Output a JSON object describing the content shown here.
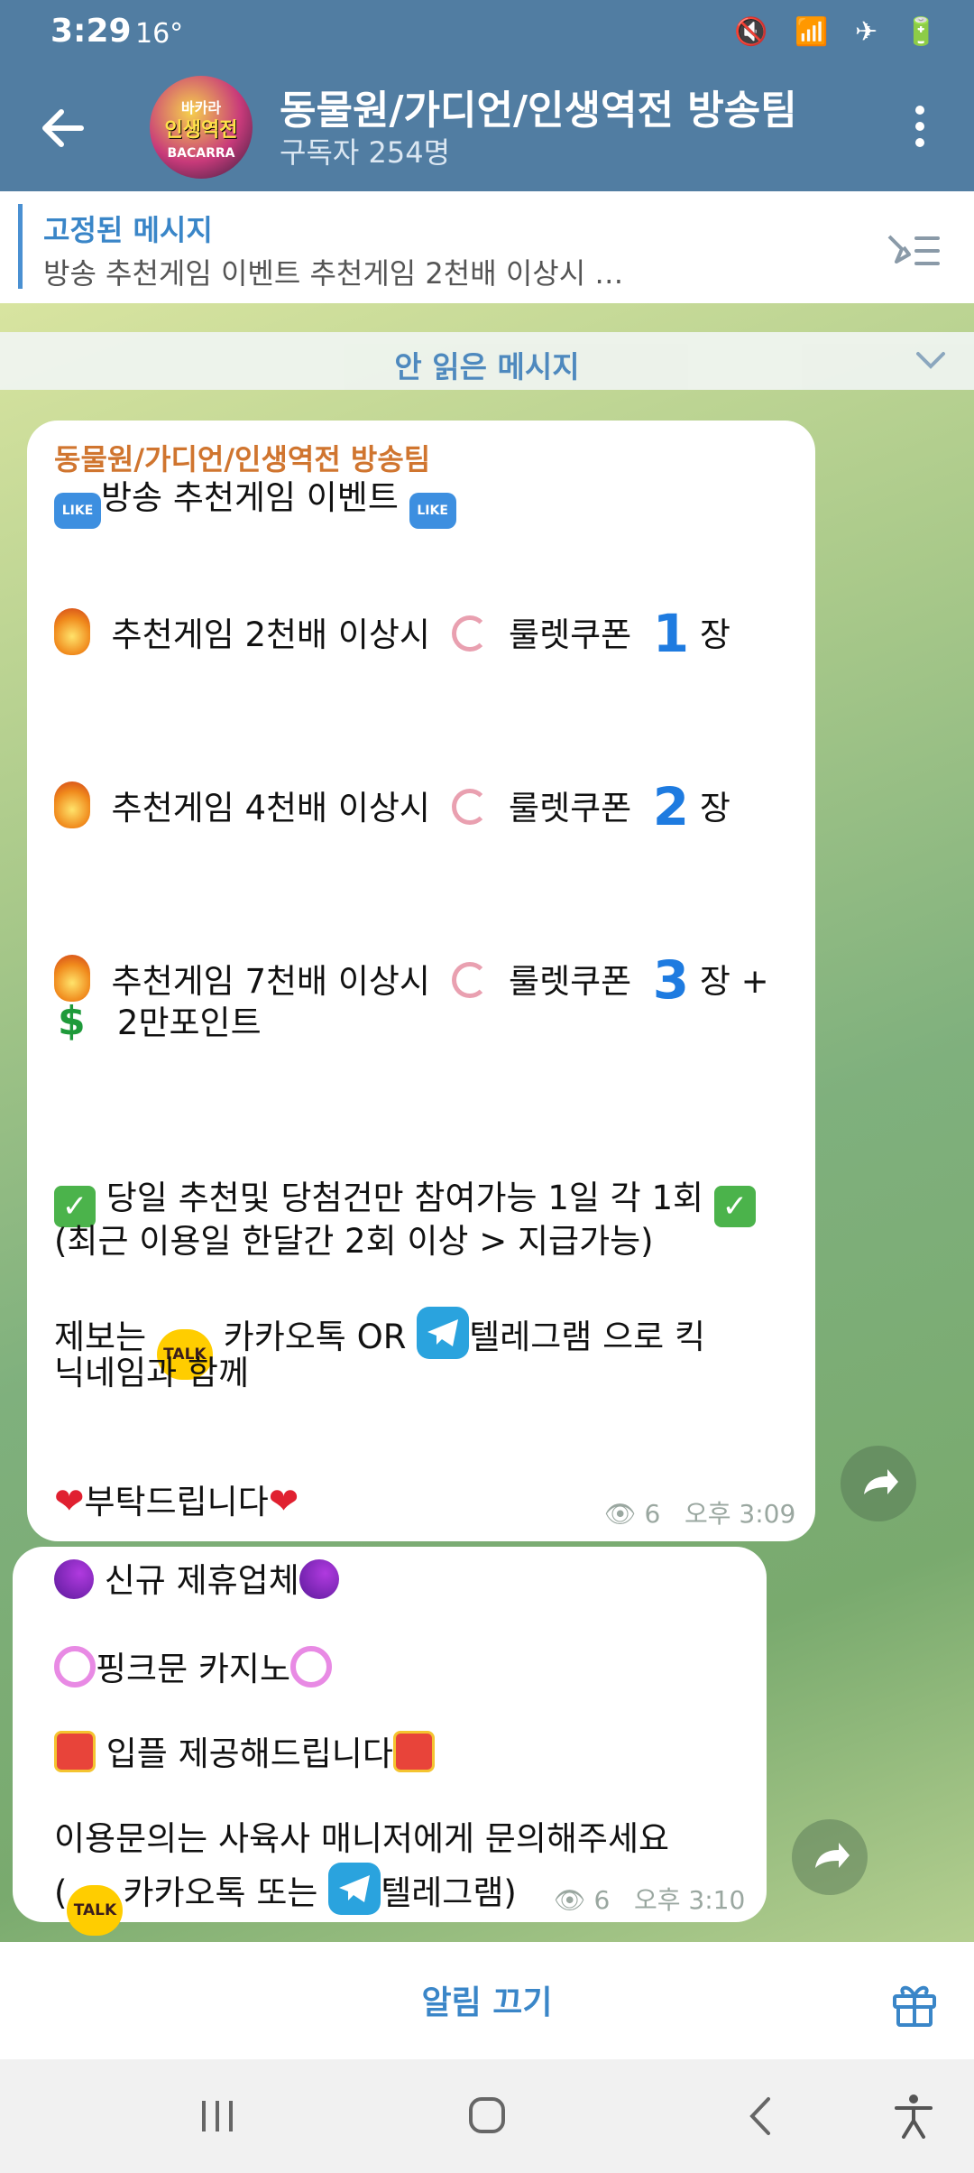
{
  "status_bar": {
    "time": "3:29",
    "temp": "16°",
    "icons": "🔇 📶 ✈ 🔋"
  },
  "header": {
    "title": "동물원/가디언/인생역전 방송팀",
    "subtitle": "구독자 254명",
    "avatar_text": [
      "바카라",
      "인생역전",
      "BACARRA"
    ]
  },
  "pinned": {
    "title": "고정된 메시지",
    "text": "방송 추천게임 이벤트      추천게임 2천배 이상시 …"
  },
  "unread_label": "안 읽은 메시지",
  "messages": [
    {
      "sender": "동물원/가디언/인생역전 방송팀",
      "lines": {
        "title": "방송 추천게임 이벤트",
        "r1_a": "추천게임 2천배 이상시",
        "r1_b": "룰렛쿠폰",
        "r1_n": "1",
        "r1_c": "장",
        "r2_a": "추천게임 4천배 이상시",
        "r2_b": "룰렛쿠폰",
        "r2_n": "2",
        "r2_c": "장",
        "r3_a": "추천게임 7천배 이상시",
        "r3_b": "룰렛쿠폰",
        "r3_n": "3",
        "r3_c": "장 +",
        "r3_d": "2만포인트",
        "notice1": "당일 추천및 당첨건만 참여가능 1일 각 1회",
        "notice2": "(최근 이용일 한달간 2회 이상 > 지급가능)",
        "report_a": "제보는",
        "report_b": "카카오톡 OR",
        "report_c": "텔레그램 으로 킥",
        "report_d": "닉네임과 함께",
        "closing": "부탁드립니다"
      },
      "views": "6",
      "time": "오후 3:09"
    },
    {
      "lines": {
        "l1": "신규 제휴업체",
        "l2": "핑크문 카지노",
        "l3": "입플 제공해드립니다",
        "l4": "이용문의는 사육사 매니저에게 문의해주세요",
        "l5_a": "(",
        "l5_b": "카카오톡 또는",
        "l5_c": "텔레그램)"
      },
      "views": "6",
      "time": "오후 3:10"
    }
  ],
  "bottom": {
    "mute_label": "알림 끄기"
  },
  "badges": {
    "like": "LIKE",
    "talk": "TALK",
    "dollar": "$"
  },
  "colors": {
    "header_bg": "#517da2",
    "accent": "#3a86c8",
    "sender": "#d0752f"
  }
}
